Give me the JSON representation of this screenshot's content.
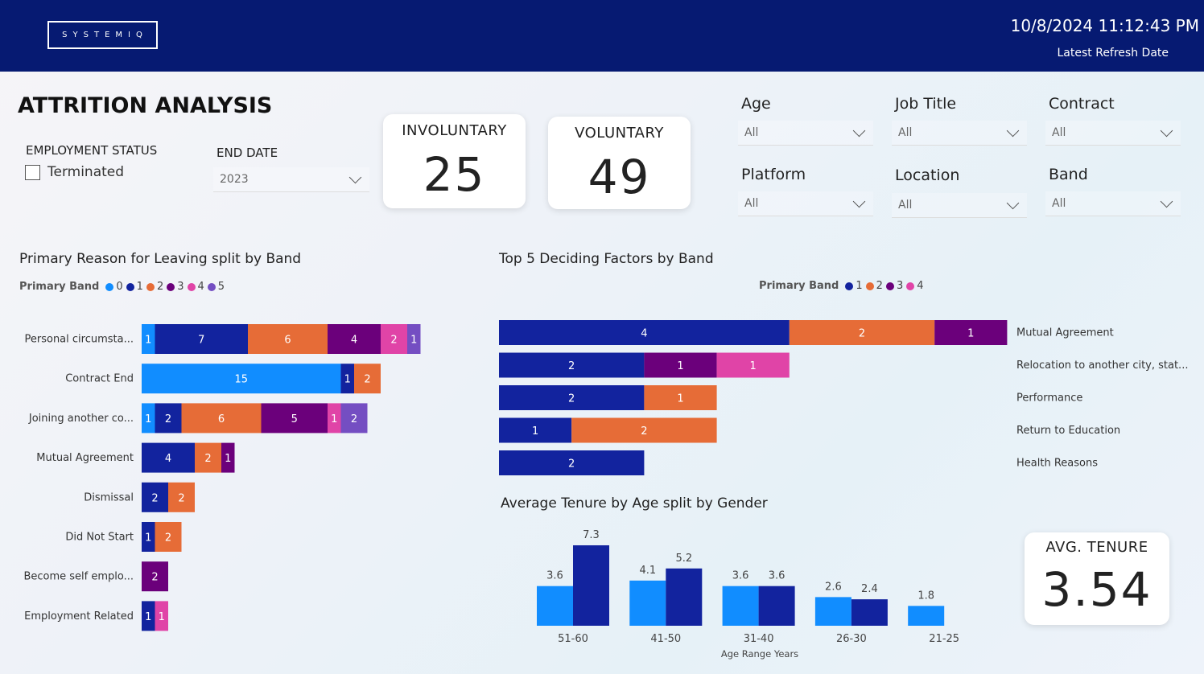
{
  "header": {
    "logo_text": "SYSTEMIQ",
    "refresh_datetime": "10/8/2024 11:12:43 PM",
    "refresh_label": "Latest Refresh Date"
  },
  "page": {
    "title": "ATTRITION ANALYSIS"
  },
  "filters": {
    "employment_status": {
      "label": "EMPLOYMENT STATUS",
      "option": "Terminated",
      "checked": false
    },
    "end_date": {
      "label": "END DATE",
      "value": "2023"
    },
    "age": {
      "label": "Age",
      "value": "All"
    },
    "job_title": {
      "label": "Job Title",
      "value": "All"
    },
    "contract": {
      "label": "Contract",
      "value": "All"
    },
    "platform": {
      "label": "Platform",
      "value": "All"
    },
    "location": {
      "label": "Location",
      "value": "All"
    },
    "band": {
      "label": "Band",
      "value": "All"
    }
  },
  "kpis": {
    "involuntary": {
      "label": "INVOLUNTARY",
      "value": "25"
    },
    "voluntary": {
      "label": "VOLUNTARY",
      "value": "49"
    },
    "avg_tenure": {
      "label": "AVG. TENURE",
      "value": "3.54"
    }
  },
  "colors": {
    "band_0": "#118dff",
    "band_1": "#12239e",
    "band_2": "#e66c37",
    "band_3": "#6b007b",
    "band_4": "#e044a7",
    "band_5": "#744ec2"
  },
  "chart_data": [
    {
      "id": "reasons",
      "type": "bar",
      "orientation": "horizontal",
      "stacked": true,
      "title": "Primary Reason for Leaving split by Band",
      "legend_title": "Primary Band",
      "categories": [
        "Personal circumsta...",
        "Contract End",
        "Joining another co...",
        "Mutual Agreement",
        "Dismissal",
        "Did Not Start",
        "Become self emplo...",
        "Employment Related"
      ],
      "series": [
        {
          "name": "0",
          "color": "#118dff",
          "values": [
            1,
            15,
            1,
            0,
            0,
            0,
            0,
            0
          ]
        },
        {
          "name": "1",
          "color": "#12239e",
          "values": [
            7,
            1,
            2,
            4,
            2,
            1,
            0,
            1
          ]
        },
        {
          "name": "2",
          "color": "#e66c37",
          "values": [
            6,
            2,
            6,
            2,
            2,
            2,
            0,
            0
          ]
        },
        {
          "name": "3",
          "color": "#6b007b",
          "values": [
            4,
            0,
            5,
            1,
            0,
            0,
            2,
            0
          ]
        },
        {
          "name": "4",
          "color": "#e044a7",
          "values": [
            2,
            0,
            1,
            0,
            0,
            0,
            0,
            1
          ]
        },
        {
          "name": "5",
          "color": "#744ec2",
          "values": [
            1,
            0,
            2,
            0,
            0,
            0,
            0,
            0
          ]
        }
      ]
    },
    {
      "id": "factors",
      "type": "bar",
      "orientation": "horizontal",
      "stacked": true,
      "title": "Top 5 Deciding Factors by Band",
      "legend_title": "Primary Band",
      "categories": [
        "Mutual Agreement",
        "Relocation to another city, stat...",
        "Performance",
        "Return to Education",
        "Health Reasons"
      ],
      "series": [
        {
          "name": "1",
          "color": "#12239e",
          "values": [
            4,
            2,
            2,
            1,
            2
          ]
        },
        {
          "name": "2",
          "color": "#e66c37",
          "values": [
            2,
            0,
            1,
            2,
            0
          ]
        },
        {
          "name": "3",
          "color": "#6b007b",
          "values": [
            1,
            1,
            0,
            0,
            0
          ]
        },
        {
          "name": "4",
          "color": "#e044a7",
          "values": [
            0,
            1,
            0,
            0,
            0
          ]
        }
      ]
    },
    {
      "id": "tenure",
      "type": "bar",
      "orientation": "vertical",
      "stacked": false,
      "title": "Average Tenure by Age split by Gender",
      "xlabel": "Age Range Years",
      "categories": [
        "51-60",
        "41-50",
        "31-40",
        "26-30",
        "21-25"
      ],
      "series": [
        {
          "color": "#118dff",
          "values": [
            3.6,
            4.1,
            3.6,
            2.6,
            1.8
          ]
        },
        {
          "color": "#12239e",
          "values": [
            7.3,
            5.2,
            3.6,
            2.4,
            null
          ]
        }
      ]
    }
  ]
}
